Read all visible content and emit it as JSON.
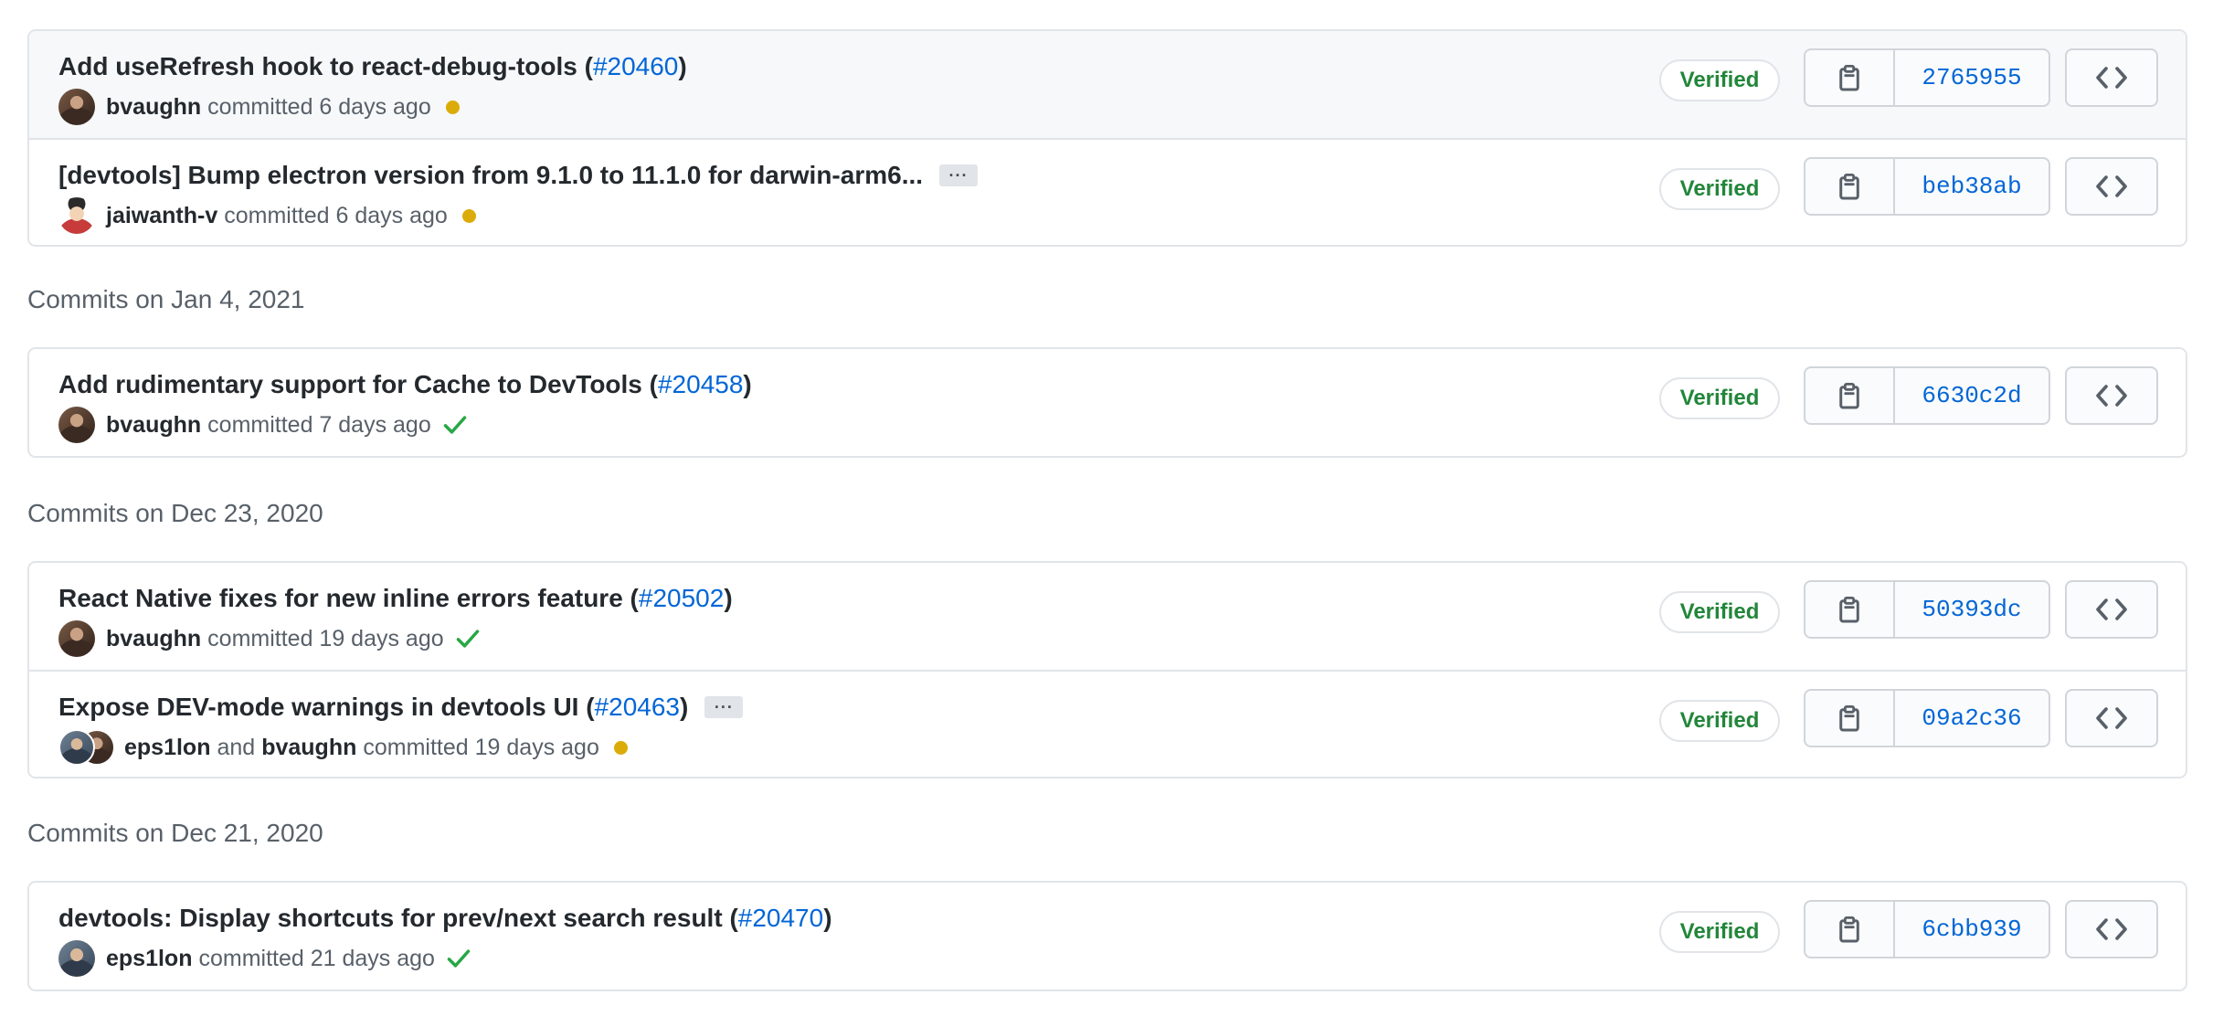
{
  "colors": {
    "link": "#0366d6",
    "verified_text": "#22863a",
    "pending_dot": "#dbab09",
    "success_check": "#28a745",
    "border": "#e1e4e8",
    "highlight_bg": "#f6f8fa"
  },
  "groups": [
    {
      "heading": "",
      "commits": [
        {
          "title": "Add useRefresh hook to react-debug-tools (",
          "pr": "#20460",
          "title_suffix": ")",
          "authors": [
            "bvaughn"
          ],
          "connector": "",
          "meta": "committed 6 days ago",
          "status": "pending",
          "status_icon": "dot-icon",
          "verified": "Verified",
          "sha": "2765955",
          "highlighted": true,
          "has_ellipsis": false
        },
        {
          "title": "[devtools] Bump electron version from 9.1.0 to 11.1.0 for darwin-arm6...",
          "pr": "",
          "title_suffix": "",
          "ellipsis": "···",
          "authors": [
            "jaiwanth-v"
          ],
          "connector": "",
          "meta": "committed 6 days ago",
          "status": "pending",
          "status_icon": "dot-icon",
          "verified": "Verified",
          "sha": "beb38ab",
          "highlighted": false,
          "has_ellipsis": true
        }
      ]
    },
    {
      "heading": "Commits on Jan 4, 2021",
      "commits": [
        {
          "title": "Add rudimentary support for Cache to DevTools (",
          "pr": "#20458",
          "title_suffix": ")",
          "authors": [
            "bvaughn"
          ],
          "connector": "",
          "meta": "committed 7 days ago",
          "status": "success",
          "status_icon": "check-icon",
          "verified": "Verified",
          "sha": "6630c2d",
          "highlighted": false,
          "has_ellipsis": false
        }
      ]
    },
    {
      "heading": "Commits on Dec 23, 2020",
      "commits": [
        {
          "title": "React Native fixes for new inline errors feature (",
          "pr": "#20502",
          "title_suffix": ")",
          "authors": [
            "bvaughn"
          ],
          "connector": "",
          "meta": "committed 19 days ago",
          "status": "success",
          "status_icon": "check-icon",
          "verified": "Verified",
          "sha": "50393dc",
          "highlighted": false,
          "has_ellipsis": false
        },
        {
          "title": "Expose DEV-mode warnings in devtools UI (",
          "pr": "#20463",
          "title_suffix": ")",
          "ellipsis": "···",
          "authors": [
            "eps1lon",
            "bvaughn"
          ],
          "connector": "and",
          "meta": "committed 19 days ago",
          "status": "pending",
          "status_icon": "dot-icon",
          "verified": "Verified",
          "sha": "09a2c36",
          "highlighted": false,
          "has_ellipsis": true
        }
      ]
    },
    {
      "heading": "Commits on Dec 21, 2020",
      "commits": [
        {
          "title": "devtools: Display shortcuts for prev/next search result (",
          "pr": "#20470",
          "title_suffix": ")",
          "authors": [
            "eps1lon"
          ],
          "connector": "",
          "meta": "committed 21 days ago",
          "status": "success",
          "status_icon": "check-icon",
          "verified": "Verified",
          "sha": "6cbb939",
          "highlighted": false,
          "has_ellipsis": false
        }
      ]
    }
  ],
  "icons": {
    "copy": "clipboard-icon",
    "browse": "code-icon"
  }
}
